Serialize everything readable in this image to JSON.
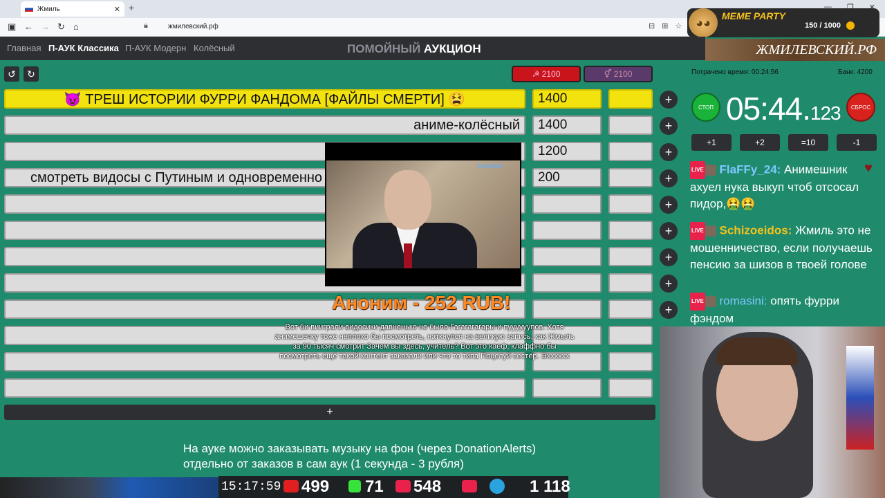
{
  "browser": {
    "tab_title": "Жмиль",
    "url": "жмилевский.рф",
    "new_tab": "+",
    "win_min": "—",
    "win_max": "❐",
    "win_close": "✕",
    "tab_close": "✕"
  },
  "overlay": {
    "meme_title": "MEME PARTY",
    "meme_count": "150 / 1000",
    "site_banner": "ЖМИЛЕВСКИЙ.РФ"
  },
  "site": {
    "nav": [
      "Главная",
      "П-АУК Классика",
      "П-АУК Модерн",
      "Колёсный"
    ],
    "logo_dim": "ПОМОЙНЫЙ",
    "logo_bold": "АУКЦИОН",
    "undo": "↺",
    "redo": "↻",
    "score_red": "☭ 2100",
    "score_purple": "⚥ 2100",
    "add_row": "+"
  },
  "lots": [
    {
      "name": "😈 ТРЕШ ИСТОРИИ ФУРРИ ФАНДОМА [ФАЙЛЫ СМЕРТИ] 😫",
      "amount": "1400",
      "highlight": true
    },
    {
      "name": "аниме-колёсный",
      "amount": "1400"
    },
    {
      "name": "",
      "amount": "1200"
    },
    {
      "name": "смотреть видосы с Путиным и одновременно",
      "amount": "200"
    },
    {
      "name": "",
      "amount": ""
    },
    {
      "name": "",
      "amount": ""
    },
    {
      "name": "",
      "amount": ""
    },
    {
      "name": "",
      "amount": ""
    },
    {
      "name": "",
      "amount": ""
    },
    {
      "name": "",
      "amount": ""
    },
    {
      "name": "",
      "amount": ""
    },
    {
      "name": "",
      "amount": ""
    }
  ],
  "donation": {
    "video_brand": "bazava",
    "donor": "Аноним - 252 RUB!",
    "message": "Вот би вииграли видосики давненько не было Гагагагагары и пуууууупов. Хотя анимешечку тоже неплохо бы посмотреть, наткнулся на великую запись, как Жмыль за 90 тысяч смотрит Зачем вы здесь, учитель? Вот это каеф, клаффно бы посмотреть ещё такой контент заказали или что то типа Поцелуй сестёр. Эхххххх"
  },
  "info": {
    "line1": "На ауке можно заказывать музыку на фон (через DonationAlerts)",
    "line2": "отдельно от заказов в сам аук (1 секунда - 3 рубля)"
  },
  "bottom_bar": {
    "clock": "15:17:59",
    "youtube": "499",
    "kick": "71",
    "vklive": "548",
    "telegram": "1 118"
  },
  "timer": {
    "spent": "Потрачено время: 00:24:56",
    "bank": "Банк: 4200",
    "stop": "СТОП",
    "reset": "СБРОС",
    "main": "05:44.",
    "ms": "123",
    "buttons": [
      "+1",
      "+2",
      "=10",
      "-1"
    ]
  },
  "chat": [
    {
      "nick": "FlaFFy_24:",
      "text": " Анимешник ахуел нука выкуп чтоб отсосал пидор,🤮🤮",
      "color": "#7ec8ff"
    },
    {
      "nick": "Schizoeidos:",
      "text": " Жмиль это не мошенничество, если получаешь пенсию за шизов в твоей голове",
      "color": "#f6c21c"
    },
    {
      "nick": "romasini:",
      "text": " опять фурри фэндом",
      "color": "#7ec8ff"
    }
  ],
  "colors": {
    "background": "#1f8a6c",
    "highlight": "#f2e30f",
    "dark": "#2d2f33",
    "stop": "#19b33a",
    "reset": "#d8221e"
  }
}
